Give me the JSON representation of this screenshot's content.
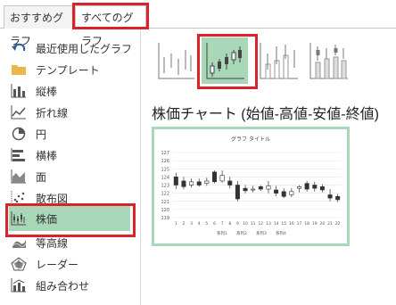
{
  "tabs": [
    {
      "label": "おすすめグラフ"
    },
    {
      "label": "すべてのグラフ"
    }
  ],
  "sidebar": {
    "items": [
      {
        "label": "最近使用したグラフ",
        "icon": "recent-undo-icon"
      },
      {
        "label": "テンプレート",
        "icon": "folder-icon"
      },
      {
        "label": "縦棒",
        "icon": "column-chart-icon"
      },
      {
        "label": "折れ線",
        "icon": "line-chart-icon"
      },
      {
        "label": "円",
        "icon": "pie-chart-icon"
      },
      {
        "label": "横棒",
        "icon": "bar-chart-icon"
      },
      {
        "label": "面",
        "icon": "area-chart-icon"
      },
      {
        "label": "散布図",
        "icon": "scatter-chart-icon"
      },
      {
        "label": "株価",
        "icon": "stock-chart-icon"
      },
      {
        "label": "等高線",
        "icon": "surface-chart-icon"
      },
      {
        "label": "レーダー",
        "icon": "radar-chart-icon"
      },
      {
        "label": "組み合わせ",
        "icon": "combo-chart-icon"
      }
    ],
    "selected_index": 8
  },
  "subtypes": [
    {
      "name": "high-low-close"
    },
    {
      "name": "open-high-low-close"
    },
    {
      "name": "volume-high-low-close"
    },
    {
      "name": "volume-open-high-low-close"
    }
  ],
  "selected_subtype_title": "株価チャート (始値-高値-安値-終値)",
  "colors": {
    "accent_green": "#a9d8b8",
    "highlight_red": "#d9232a"
  },
  "chart_data": {
    "type": "candlestick",
    "title": "グラフ タイトル",
    "ylim": [
      119,
      127
    ],
    "yticks": [
      "119",
      "120",
      "121",
      "122",
      "123",
      "124",
      "125",
      "126",
      "127"
    ],
    "categories": [
      "1",
      "2",
      "3",
      "4",
      "5",
      "6",
      "7",
      "8",
      "9",
      "10",
      "11",
      "12",
      "13",
      "14",
      "15",
      "16",
      "17",
      "18",
      "19",
      "20",
      "21",
      "22"
    ],
    "series": [
      {
        "open": 124.0,
        "close": 123.0,
        "high": 124.5,
        "low": 122.5
      },
      {
        "open": 123.5,
        "close": 122.8,
        "high": 124.0,
        "low": 122.5
      },
      {
        "open": 123.0,
        "close": 123.4,
        "high": 123.8,
        "low": 122.7
      },
      {
        "open": 123.4,
        "close": 123.0,
        "high": 123.8,
        "low": 122.8
      },
      {
        "open": 123.2,
        "close": 123.5,
        "high": 123.9,
        "low": 122.9
      },
      {
        "open": 124.6,
        "close": 123.4,
        "high": 124.8,
        "low": 123.2
      },
      {
        "open": 123.5,
        "close": 124.2,
        "high": 124.8,
        "low": 123.3
      },
      {
        "open": 123.5,
        "close": 123.0,
        "high": 124.0,
        "low": 122.6
      },
      {
        "open": 123.0,
        "close": 121.3,
        "high": 123.5,
        "low": 121.0
      },
      {
        "open": 122.6,
        "close": 122.3,
        "high": 123.0,
        "low": 122.0
      },
      {
        "open": 122.4,
        "close": 122.5,
        "high": 122.9,
        "low": 122.1
      },
      {
        "open": 122.8,
        "close": 122.5,
        "high": 123.0,
        "low": 122.3
      },
      {
        "open": 122.5,
        "close": 122.9,
        "high": 123.5,
        "low": 122.0
      },
      {
        "open": 122.4,
        "close": 122.0,
        "high": 122.9,
        "low": 121.6
      },
      {
        "open": 122.2,
        "close": 121.6,
        "high": 122.6,
        "low": 121.4
      },
      {
        "open": 121.8,
        "close": 122.2,
        "high": 122.6,
        "low": 121.5
      },
      {
        "open": 122.6,
        "close": 122.8,
        "high": 123.0,
        "low": 122.1
      },
      {
        "open": 123.2,
        "close": 122.5,
        "high": 123.5,
        "low": 122.2
      },
      {
        "open": 123.0,
        "close": 122.6,
        "high": 123.4,
        "low": 122.2
      },
      {
        "open": 122.8,
        "close": 122.4,
        "high": 123.1,
        "low": 122.1
      },
      {
        "open": 121.8,
        "close": 121.4,
        "high": 122.5,
        "low": 121.0
      },
      {
        "open": 121.6,
        "close": 121.2,
        "high": 121.9,
        "low": 120.9
      }
    ],
    "legend": [
      "系列1",
      "系列2",
      "系列3",
      "系列4"
    ],
    "grid": true
  }
}
